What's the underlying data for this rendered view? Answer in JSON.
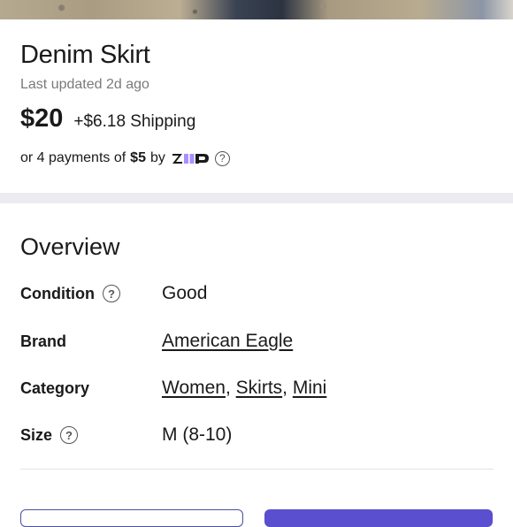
{
  "listing": {
    "title": "Denim Skirt",
    "last_updated": "Last updated 2d ago",
    "price": "$20",
    "shipping": "+$6.18 Shipping"
  },
  "payments": {
    "prefix": "or 4 payments of",
    "amount": "$5",
    "by": "by",
    "provider": "zip",
    "help_icon": "?"
  },
  "overview": {
    "heading": "Overview",
    "rows": [
      {
        "label": "Condition",
        "has_help": true,
        "value": "Good"
      },
      {
        "label": "Brand",
        "has_help": false,
        "links": [
          "American Eagle"
        ]
      },
      {
        "label": "Category",
        "has_help": false,
        "links": [
          "Women",
          "Skirts",
          "Mini"
        ],
        "separator": ", "
      },
      {
        "label": "Size",
        "has_help": true,
        "value": "M (8-10)"
      }
    ],
    "help_icon": "?"
  },
  "colors": {
    "accent": "#5a4fcf",
    "zip_purple": "#aa8fff",
    "band": "#ececf0"
  }
}
